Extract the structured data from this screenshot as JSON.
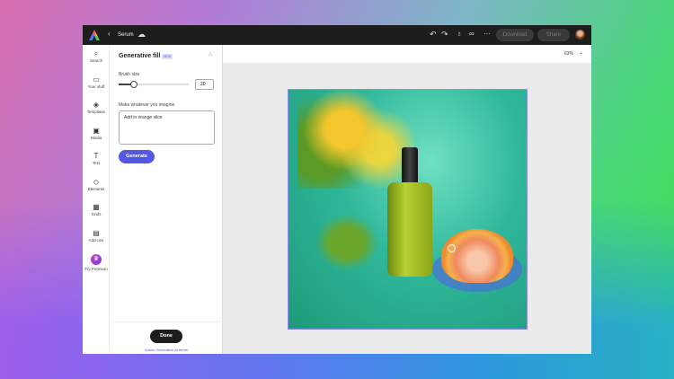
{
  "header": {
    "title": "Serum",
    "download": "Download",
    "share": "Share"
  },
  "rail": [
    {
      "label": "Search",
      "icon": "search-icon"
    },
    {
      "label": "Your stuff",
      "icon": "folder-icon"
    },
    {
      "label": "Templates",
      "icon": "templates-icon"
    },
    {
      "label": "Media",
      "icon": "media-icon"
    },
    {
      "label": "Text",
      "icon": "text-icon"
    },
    {
      "label": "Elements",
      "icon": "elements-icon"
    },
    {
      "label": "Grids",
      "icon": "grid-icon"
    },
    {
      "label": "Add-ons",
      "icon": "addons-icon"
    },
    {
      "label": "Try Premium",
      "icon": "crown-icon"
    }
  ],
  "panel": {
    "title": "Generative fill",
    "badge": "NEW",
    "brush_label": "Brush size",
    "brush_value": "20",
    "brush_fraction": 0.22,
    "prompt_label": "Make whatever you imagine",
    "prompt_value": "Add in orange slice",
    "generate": "Generate",
    "done": "Done",
    "terms": "Adobe Generative AI terms"
  },
  "canvas": {
    "zoom": "63%"
  },
  "colors": {
    "accent": "#5258e4",
    "topbar": "#1d1d1d"
  }
}
